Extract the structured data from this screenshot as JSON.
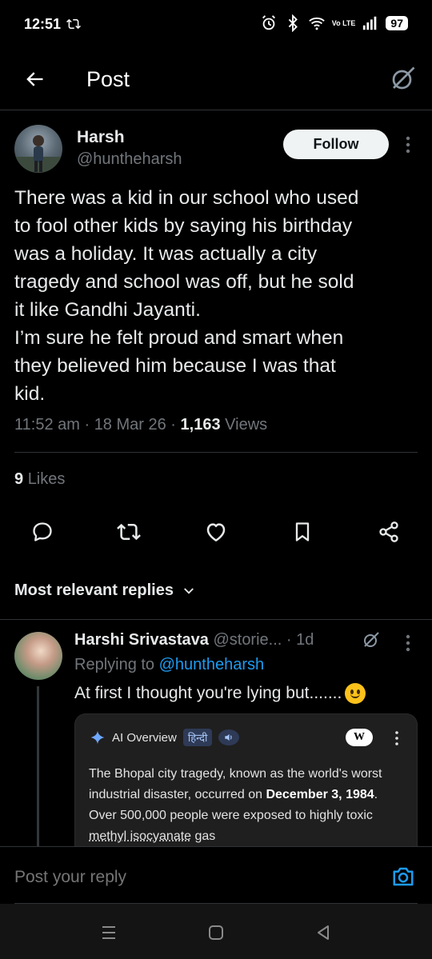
{
  "status_bar": {
    "time": "12:51",
    "volte": "Vo LTE",
    "battery": "97"
  },
  "header": {
    "title": "Post"
  },
  "post": {
    "author_name": "Harsh",
    "author_handle": "@huntheharsh",
    "follow_label": "Follow",
    "body_lines": [
      "There was a kid in our school who used",
      "to fool other kids by saying his birthday",
      "was a holiday. It was actually a city",
      "tragedy and school was off, but he sold",
      "it like Gandhi Jayanti.",
      "I’m sure he felt proud and smart when",
      "they believed him because I was that",
      "kid."
    ],
    "time": "11:52 am",
    "date": "18 Mar 26",
    "views_count": "1,163",
    "views_label": "Views",
    "likes_count": "9",
    "likes_label": "Likes"
  },
  "replies": {
    "sort_label": "Most relevant replies",
    "items": [
      {
        "name": "Harshi Srivastava",
        "handle": "@storie...",
        "age": "· 1d",
        "replying_prefix": "Replying to",
        "replying_handle": "@huntheharsh",
        "text": "At first I thought you're lying but......."
      }
    ]
  },
  "ai_card": {
    "title": "AI Overview",
    "hindi": "हिन्दी",
    "wiki": "W",
    "text_1": "The Bhopal city tragedy, known as the world's worst industrial disaster, occurred on ",
    "text_bold": "December 3, 1984",
    "text_2": ". Over 500,000 people were exposed to highly toxic ",
    "text_dotted": "methyl isocyanate",
    "text_3": " gas"
  },
  "compose": {
    "placeholder": "Post your reply"
  },
  "colors": {
    "accent": "#1d9bf0",
    "muted": "#71767b",
    "text": "#e7e9ea",
    "background": "#000000"
  }
}
